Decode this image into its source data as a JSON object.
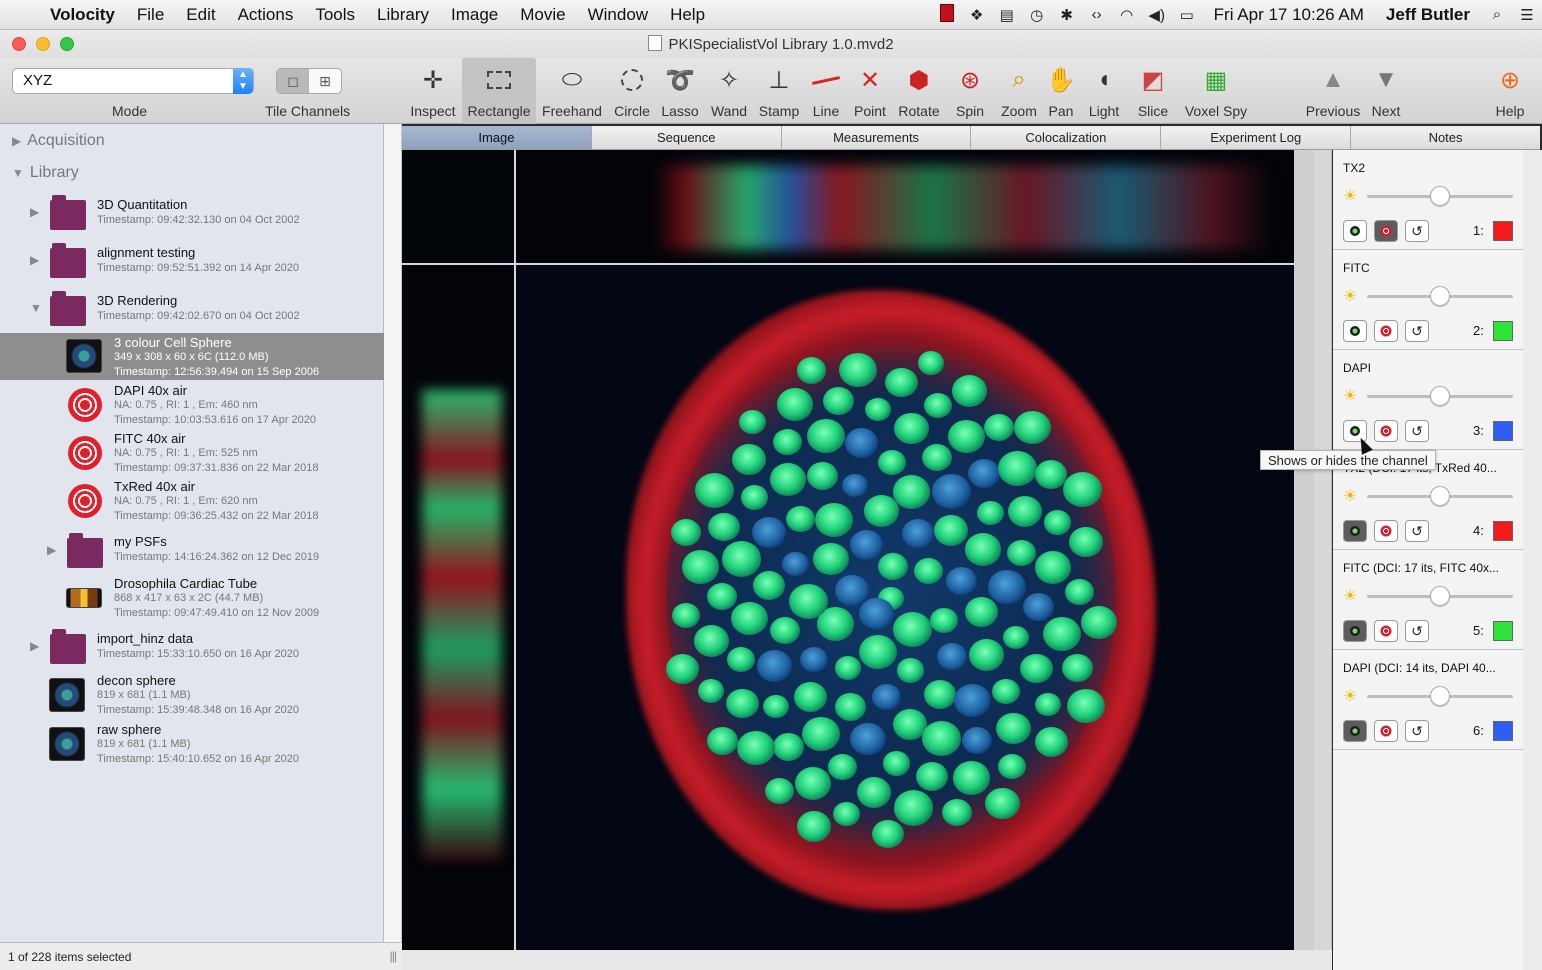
{
  "menubar": {
    "app": "Volocity",
    "items": [
      "File",
      "Edit",
      "Actions",
      "Tools",
      "Library",
      "Image",
      "Movie",
      "Window",
      "Help"
    ],
    "clock": "Fri Apr 17  10:26 AM",
    "user": "Jeff Butler"
  },
  "window": {
    "title": "PKISpecialistVol Library 1.0.mvd2"
  },
  "toolbar": {
    "mode_value": "XYZ",
    "mode_label": "Mode",
    "tile_label": "Tile Channels",
    "tools": [
      "Inspect",
      "Rectangle",
      "Freehand",
      "Circle",
      "Lasso",
      "Wand",
      "Stamp",
      "Line",
      "Point",
      "Rotate",
      "Spin",
      "Zoom",
      "Pan",
      "Light",
      "Slice",
      "Voxel Spy",
      "Previous",
      "Next",
      "Help"
    ]
  },
  "sidebar": {
    "acquisition": "Acquisition",
    "library": "Library",
    "items": [
      {
        "name": "3D Quantitation",
        "meta1": "Timestamp: 09:42:32.130 on 04 Oct 2002"
      },
      {
        "name": "alignment testing",
        "meta1": "Timestamp: 09:52:51.392 on 14 Apr 2020"
      },
      {
        "name": "3D Rendering",
        "meta1": "Timestamp: 09:42:02.670 on 04 Oct 2002"
      },
      {
        "name": "3 colour Cell Sphere",
        "meta1": "349 x 308 x 60 x 6C (112.0 MB)",
        "meta2": "Timestamp: 12:56:39.494 on 15 Sep 2006"
      },
      {
        "name": "DAPI 40x air",
        "meta1": "NA: 0.75 , RI: 1 , Em: 460 nm",
        "meta2": "Timestamp: 10:03:53.616 on 17 Apr 2020"
      },
      {
        "name": "FITC 40x air",
        "meta1": "NA: 0.75 , RI: 1 , Em: 525 nm",
        "meta2": "Timestamp: 09:37:31.836 on 22 Mar 2018"
      },
      {
        "name": "TxRed 40x air",
        "meta1": "NA: 0.75 , RI: 1 , Em: 620 nm",
        "meta2": "Timestamp: 09:36:25.432 on 22 Mar 2018"
      },
      {
        "name": "my PSFs",
        "meta1": "Timestamp: 14:16:24.362 on 12 Dec 2019"
      },
      {
        "name": "Drosophila Cardiac Tube",
        "meta1": "868 x 417 x 63 x 2C (44.7 MB)",
        "meta2": "Timestamp: 09:47:49.410 on 12 Nov 2009"
      },
      {
        "name": "import_hinz data",
        "meta1": "Timestamp: 15:33:10.650 on 16 Apr 2020"
      },
      {
        "name": "decon sphere",
        "meta1": "819 x 681 (1.1 MB)",
        "meta2": "Timestamp: 15:39:48.348 on 16 Apr 2020"
      },
      {
        "name": "raw sphere",
        "meta1": "819 x 681 (1.1 MB)",
        "meta2": "Timestamp: 15:40:10.652 on 16 Apr 2020"
      }
    ],
    "status": "1 of 228 items selected"
  },
  "tabs": [
    "Image",
    "Sequence",
    "Measurements",
    "Colocalization",
    "Experiment Log",
    "Notes"
  ],
  "channels": [
    {
      "name": "TX2",
      "num": "1:",
      "color": "#f21b1b",
      "level": 0.5
    },
    {
      "name": "FITC",
      "num": "2:",
      "color": "#2fe23a",
      "level": 0.5
    },
    {
      "name": "DAPI",
      "num": "3:",
      "color": "#2f5ff2",
      "level": 0.5
    },
    {
      "name": "TX2 (DCI: 17 its, TxRed 40...",
      "num": "4:",
      "color": "#f21b1b",
      "level": 0.5
    },
    {
      "name": "FITC (DCI: 17 its, FITC 40x...",
      "num": "5:",
      "color": "#2fe23a",
      "level": 0.5
    },
    {
      "name": "DAPI (DCI: 14 its, DAPI 40...",
      "num": "6:",
      "color": "#2f5ff2",
      "level": 0.5
    }
  ],
  "tooltip": "Shows or hides the channel"
}
